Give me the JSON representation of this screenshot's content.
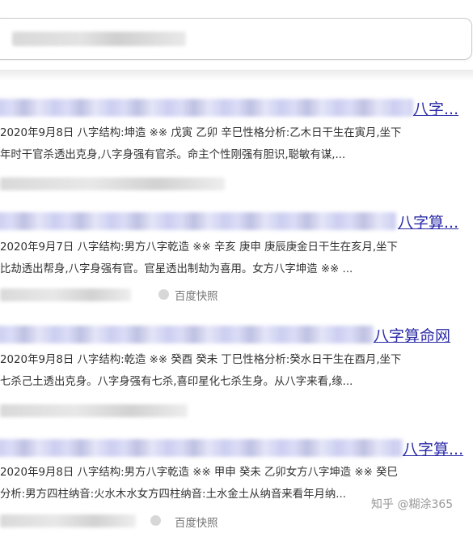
{
  "search": {
    "query": ""
  },
  "results": [
    {
      "title": "八字...",
      "line1": "2020年9月8日  八字结构:坤造 ※※ 戊寅 乙卯 辛巳性格分析:乙木日干生在寅月,坐下",
      "line2": "年时干官杀透出克身,八字身强有官杀。命主个性刚强有胆识,聪敏有谋,...",
      "cache": ""
    },
    {
      "title": "八字算...",
      "line1": "2020年9月7日  八字结构:男方八字乾造 ※※ 辛亥 庚申 庚辰庚金日干生在亥月,坐下",
      "line2": "比劫透出帮身,八字身强有官。官星透出制劫为喜用。女方八字坤造 ※※ ...",
      "cache": "百度快照"
    },
    {
      "title": "八字算命网",
      "line1": "2020年9月8日  八字结构:乾造 ※※ 癸酉 癸未 丁巳性格分析:癸水日干生在酉月,坐下",
      "line2": "七杀己土透出克身。八字身强有七杀,喜印星化七杀生身。从八字来看,缘...",
      "cache": ""
    },
    {
      "title": "八字算...",
      "line1": "2020年9月8日  八字结构:男方八字乾造 ※※ 甲申 癸未 乙卯女方八字坤造 ※※ 癸巳",
      "line2": "分析:男方四柱纳音:火水木水女方四柱纳音:土水金土从纳音来看年月纳...",
      "cache": "百度快照"
    }
  ],
  "watermark": "知乎 @糊涂365"
}
